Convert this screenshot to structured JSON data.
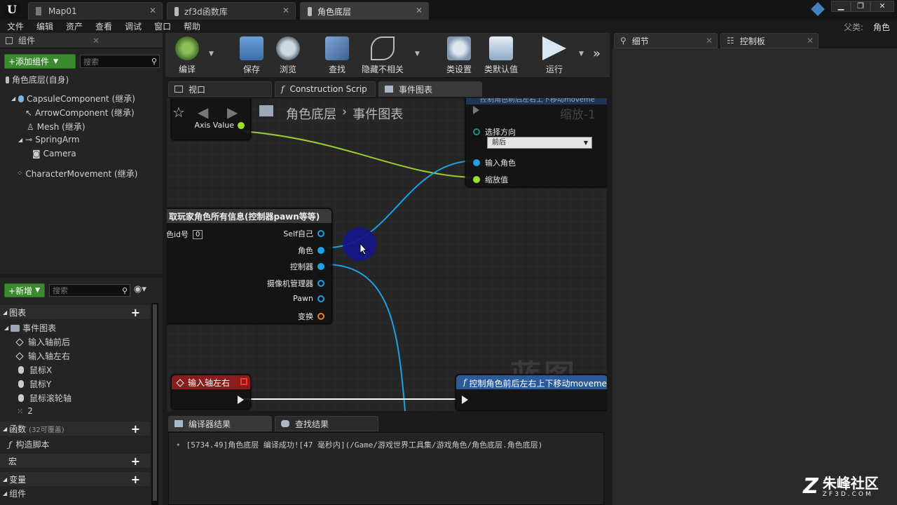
{
  "tabs": [
    {
      "label": "Map01",
      "icon": "level-icon"
    },
    {
      "label": "zf3d函数库",
      "icon": "blueprint-icon"
    },
    {
      "label": "角色底层",
      "icon": "blueprint-icon"
    }
  ],
  "menu": [
    "文件",
    "编辑",
    "资产",
    "查看",
    "调试",
    "窗口",
    "帮助"
  ],
  "parent": {
    "label": "父类:",
    "value": "角色"
  },
  "components_panel": {
    "title": "组件",
    "add_button": "+添加组件",
    "search_placeholder": "搜索",
    "root": "角色底层(自身)",
    "items": [
      "CapsuleComponent (继承)",
      "ArrowComponent (继承)",
      "Mesh (继承)",
      "SpringArm",
      "Camera",
      "CharacterMovement (继承)"
    ]
  },
  "toolbar": [
    "编译",
    "保存",
    "浏览",
    "查找",
    "隐藏不相关",
    "类设置",
    "类默认值",
    "运行"
  ],
  "editor_tabs": [
    "视口",
    "Construction Scrip",
    "事件图表"
  ],
  "breadcrumb": {
    "root": "角色底层",
    "current": "事件图表"
  },
  "graph": {
    "axis_value": "Axis Value",
    "top_right_node": {
      "title": "控制角色前后左右上下移动moveme",
      "scale_label": "缩放-1",
      "select_dir": "选择方向",
      "dir_value": "前后",
      "input_char": "输入角色",
      "scale_value": "缩放值"
    },
    "info_node": {
      "title": "取玩家角色所有信息(控制器pawn等等)",
      "id_label": "色id号",
      "id_value": "0",
      "pins": [
        "Self自己",
        "角色",
        "控制器",
        "摄像机管理器",
        "Pawn",
        "变换"
      ]
    },
    "axis_lr": "输入轴左右",
    "bottom_func": "控制角色前后左右上下移动moveme",
    "watermark": "蓝图"
  },
  "right_tabs": [
    "细节",
    "控制板"
  ],
  "mybp": {
    "new_button": "+新增",
    "search_placeholder": "搜索",
    "graphs": "图表",
    "event_graph": "事件图表",
    "events": [
      "输入轴前后",
      "输入轴左右",
      "鼠标X",
      "鼠标Y",
      "鼠标滚轮轴",
      "2"
    ],
    "functions": "函数",
    "functions_note": "(32可覆盖)",
    "construct": "构造脚本",
    "macros": "宏",
    "variables": "变量",
    "components": "组件"
  },
  "bottom_tabs": [
    "编译器结果",
    "查找结果"
  ],
  "log": "[5734.49]角色底层 编译成功![47 毫秒内](/Game/游戏世界工具集/游戏角色/角色底层.角色底层)",
  "brand": {
    "name": "朱峰社区",
    "url": "ZF3D.COM"
  }
}
